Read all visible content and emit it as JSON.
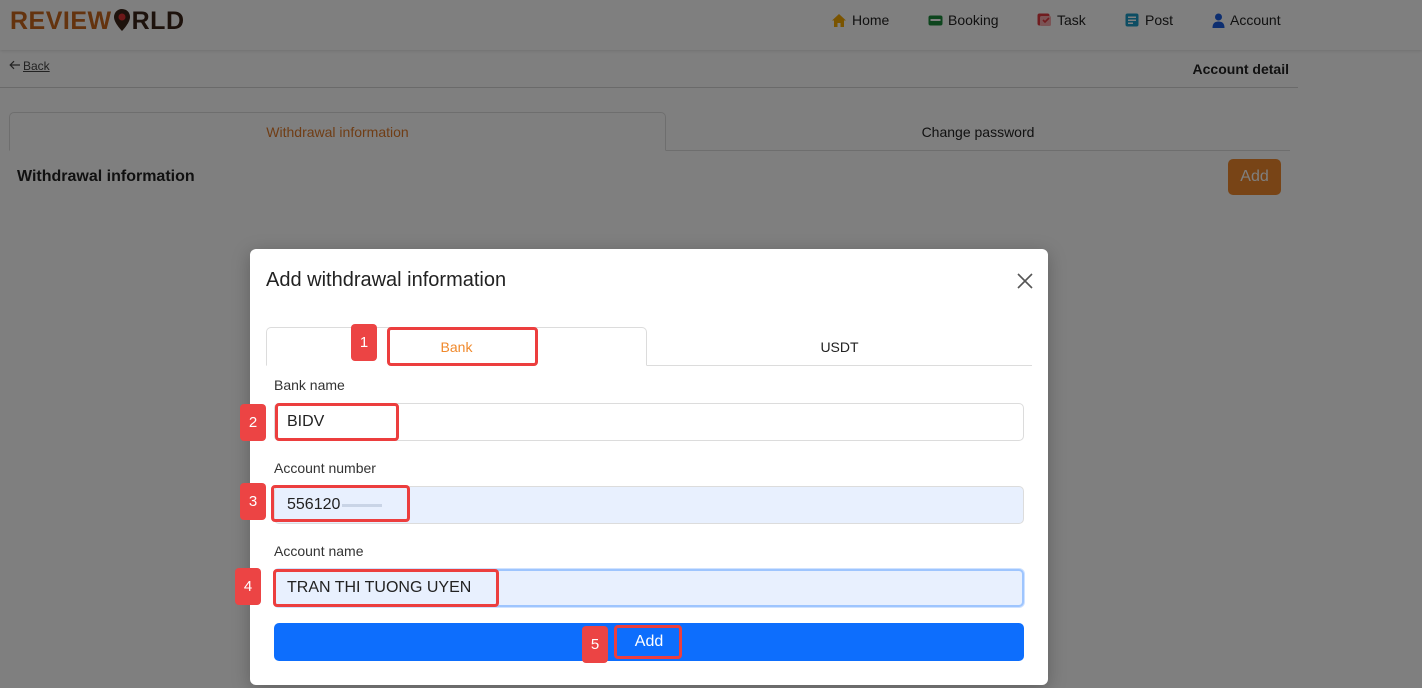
{
  "header": {
    "logo": {
      "part1": "REVIEW",
      "part2": "O",
      "part3": "RLD"
    },
    "nav": [
      {
        "label": "Home",
        "icon": "home-icon",
        "color": "#f5a800"
      },
      {
        "label": "Booking",
        "icon": "booking-icon",
        "color": "#1b8a3a"
      },
      {
        "label": "Task",
        "icon": "task-icon",
        "color": "#e0383e"
      },
      {
        "label": "Post",
        "icon": "post-icon",
        "color": "#1a9bc7"
      },
      {
        "label": "Account",
        "icon": "account-icon",
        "color": "#1a5ce0"
      }
    ]
  },
  "subheader": {
    "back_label": "Back",
    "page_title": "Account detail"
  },
  "page_card": {
    "tabs": [
      {
        "label": "Withdrawal information",
        "active": true
      },
      {
        "label": "Change password",
        "active": false
      }
    ],
    "section_title": "Withdrawal information",
    "add_label": "Add"
  },
  "modal": {
    "title": "Add withdrawal information",
    "tabs": [
      {
        "label": "Bank",
        "active": true
      },
      {
        "label": "USDT",
        "active": false
      }
    ],
    "fields": {
      "bank_name": {
        "label": "Bank name",
        "value": "BIDV"
      },
      "account_number": {
        "label": "Account number",
        "value": "556120"
      },
      "account_name": {
        "label": "Account name",
        "value": "TRAN THI TUONG UYEN"
      }
    },
    "submit_label": "Add"
  },
  "annotations": {
    "badges": [
      "1",
      "2",
      "3",
      "4",
      "5"
    ],
    "color": "#ec3e3e"
  },
  "colors": {
    "accent_orange": "#f0892c",
    "primary_blue": "#0d6efd",
    "autofill_bg": "#e8f0fe"
  }
}
